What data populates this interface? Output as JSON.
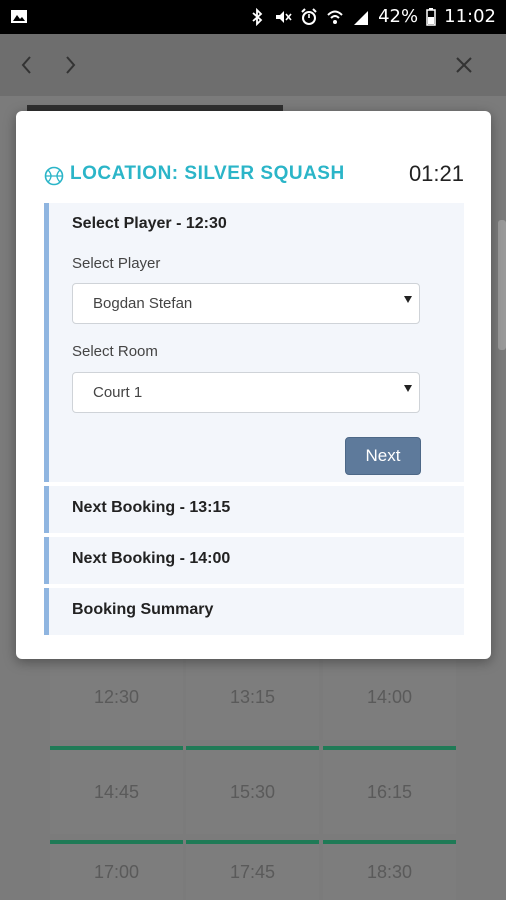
{
  "status_bar": {
    "battery": "42%",
    "time": "11:02"
  },
  "nav": {
    "back_icon": "chevron-left-icon",
    "forward_icon": "chevron-right-icon",
    "close_icon": "close-icon"
  },
  "background_slots": [
    [
      "12:30",
      "13:15",
      "14:00"
    ],
    [
      "14:45",
      "15:30",
      "16:15"
    ],
    [
      "17:00",
      "17:45",
      "18:30"
    ]
  ],
  "modal": {
    "location_title": "LOCATION: SILVER SQUASH",
    "timer": "01:21",
    "icon": "basketball-icon",
    "accent_color": "#2bb5c8",
    "select_player_panel": {
      "title": "Select Player - 12:30",
      "player_label": "Select Player",
      "player_value": "Bogdan Stefan",
      "room_label": "Select Room",
      "room_value": "Court 1",
      "next_label": "Next"
    },
    "next_booking_1": "Next Booking - 13:15",
    "next_booking_2": "Next Booking - 14:00",
    "summary": "Booking Summary"
  }
}
